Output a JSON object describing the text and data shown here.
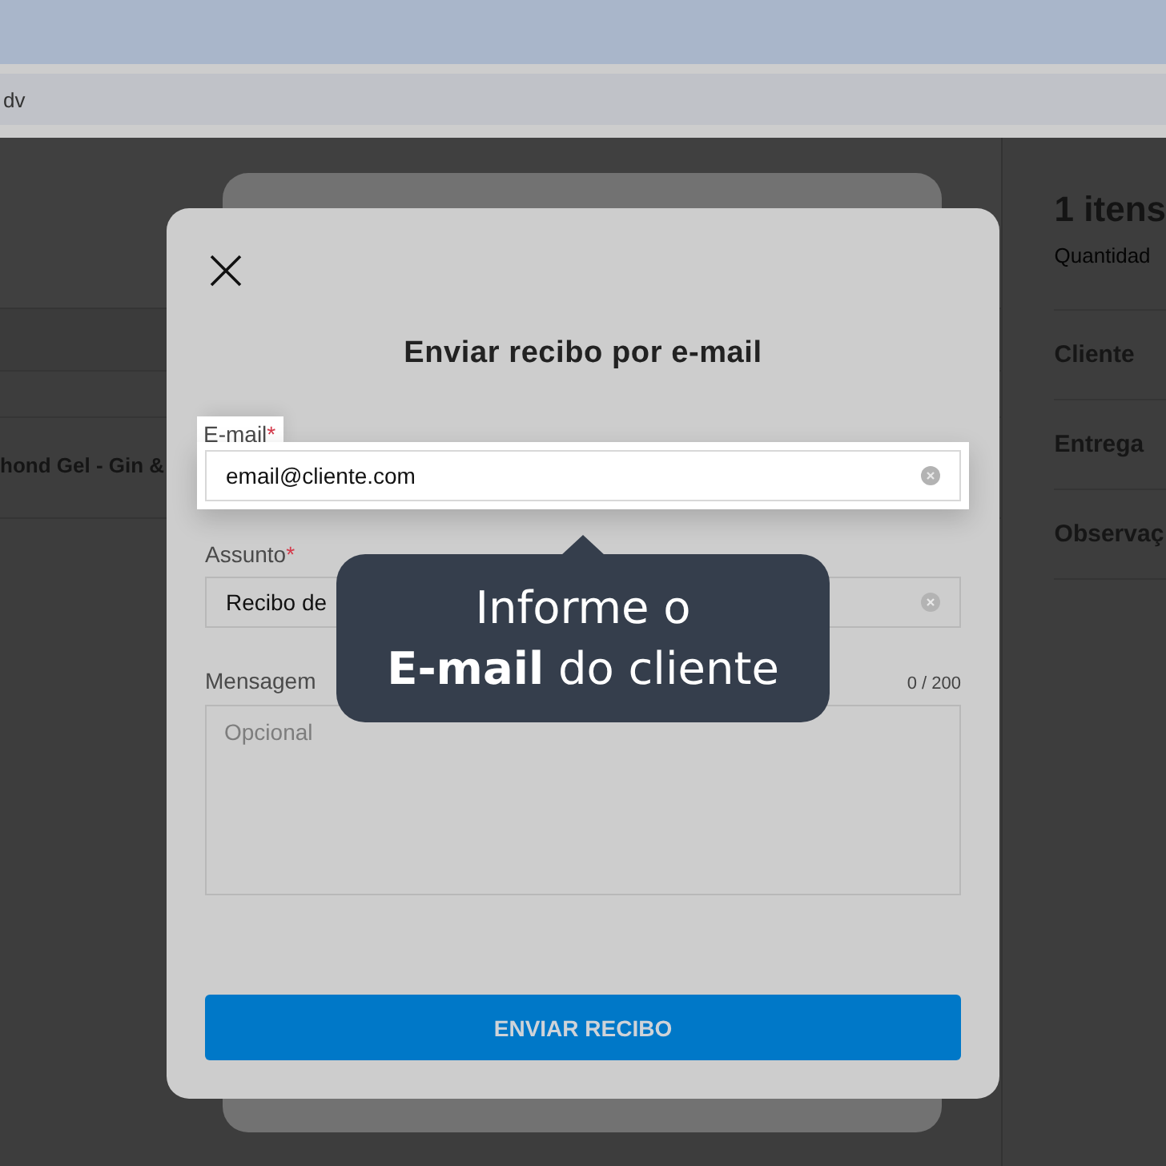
{
  "browser": {
    "address": "dv"
  },
  "background": {
    "product": "hond Gel - Gin &",
    "summary_title": "1 itens",
    "summary_subtitle": "Quantidad",
    "summary_rows": [
      "Cliente",
      "Entrega",
      "Observaç"
    ]
  },
  "modal": {
    "title": "Enviar recibo por e-mail",
    "fields": [
      {
        "kind": "input",
        "label": "E-mail",
        "required_mark": "*",
        "value": "email@cliente.com",
        "highlighted": true
      },
      {
        "kind": "input",
        "label": "Assunto",
        "required_mark": "*",
        "value": "Recibo de",
        "highlighted": false
      },
      {
        "kind": "textarea",
        "label": "Mensagem",
        "counter": "0 / 200",
        "placeholder": "Opcional",
        "highlighted": false
      }
    ],
    "button": "ENVIAR RECIBO"
  },
  "tooltip": {
    "lines": [
      "Informe o",
      "**E-mail** do cliente"
    ]
  }
}
